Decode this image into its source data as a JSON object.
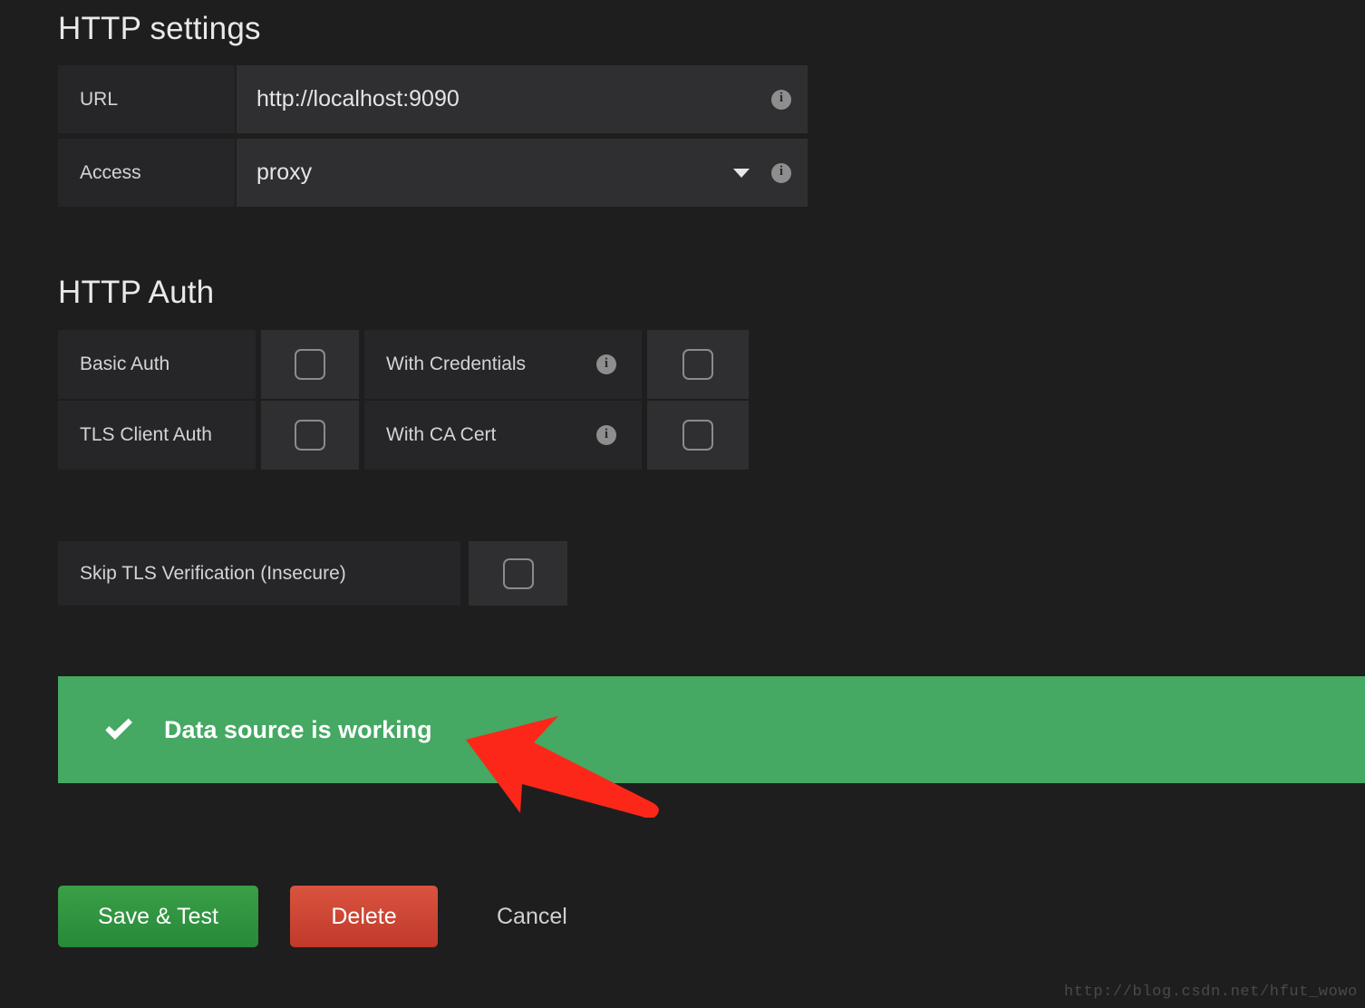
{
  "sections": {
    "http_settings": {
      "heading": "HTTP settings",
      "fields": [
        {
          "label": "URL",
          "value": "http://localhost:9090",
          "info_icon": "info-icon",
          "type": "text"
        },
        {
          "label": "Access",
          "value": "proxy",
          "info_icon": "info-icon",
          "type": "select",
          "caret_icon": "chevron-down-icon"
        }
      ]
    },
    "http_auth": {
      "heading": "HTTP Auth",
      "rows": [
        {
          "left_label": "Basic Auth",
          "left_checked": false,
          "right_label": "With Credentials",
          "right_info_icon": "info-icon",
          "right_checked": false
        },
        {
          "left_label": "TLS Client Auth",
          "left_checked": false,
          "right_label": "With CA Cert",
          "right_info_icon": "info-icon",
          "right_checked": false
        }
      ],
      "skip_tls": {
        "label": "Skip TLS Verification (Insecure)",
        "checked": false
      }
    }
  },
  "status_banner": {
    "icon": "check-icon",
    "text": "Data source is working",
    "background_color": "#45a863"
  },
  "annotation": {
    "icon": "arrow-up-left-icon",
    "color": "#fc2718"
  },
  "buttons": {
    "save_test": "Save & Test",
    "delete": "Delete",
    "cancel": "Cancel",
    "save_color": "#3a9f47",
    "delete_color": "#d9543f"
  },
  "watermark": "http://blog.csdn.net/hfut_wowo"
}
